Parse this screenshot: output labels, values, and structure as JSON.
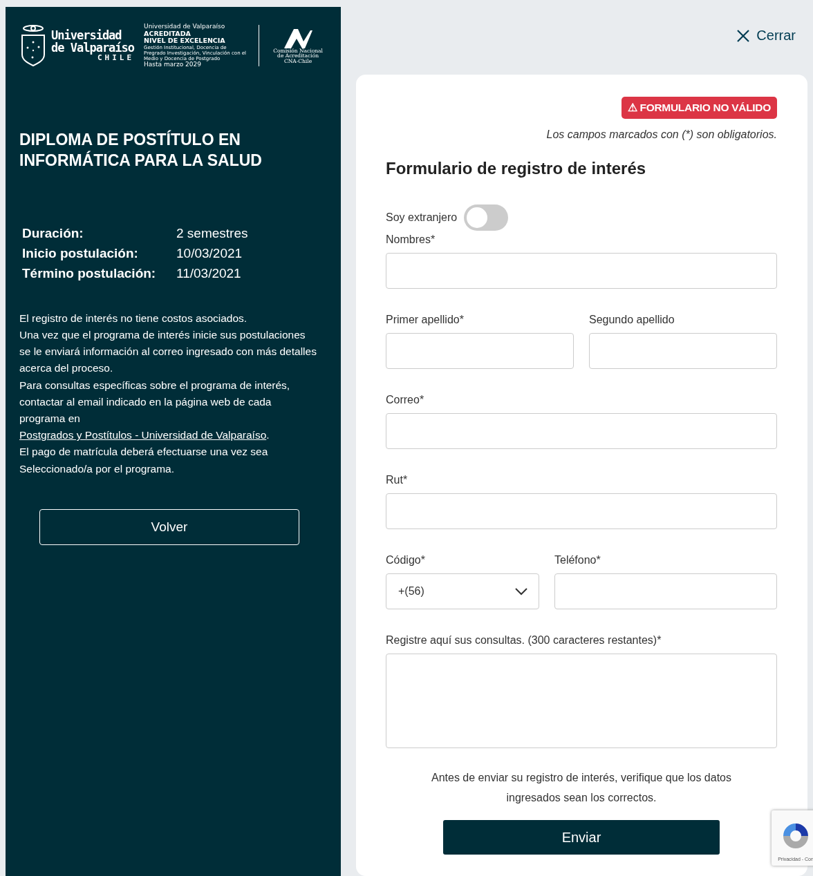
{
  "sidebar": {
    "university_logo": {
      "line_1": "Universidad",
      "line_2": "de Valparaíso",
      "line_3": "CHILE"
    },
    "accreditation": {
      "university": "Universidad de Valparaíso",
      "status": "ACREDITADA",
      "level": "NIVEL DE EXCELENCIA",
      "areas": "Gestión Institucional, Docencia de Pregrado Investigación, Vinculación con el Medio y Docencia de Postgrado",
      "until": "Hasta marzo 2029",
      "agency": "Comisión Nacional de Acreditación",
      "agency_short": "CNA-Chile"
    },
    "program_title": "DIPLOMA DE POSTÍTULO EN INFORMÁTICA PARA LA SALUD",
    "details": [
      {
        "label": "Duración:",
        "value": "2 semestres"
      },
      {
        "label": "Inicio postulación:",
        "value": "10/03/2021"
      },
      {
        "label": "Término postulación:",
        "value": "11/03/2021"
      }
    ],
    "info": [
      {
        "text": "El registro de interés no tiene costos asociados."
      },
      {
        "text": "Una vez que el programa de interés inicie sus postulaciones se le enviará información al correo ingresado con más detalles acerca del proceso."
      },
      {
        "text": "Para consultas específicas sobre el programa de interés, contactar al email indicado en la página web de cada programa en ",
        "link": "Postgrados y Postítulos - Universidad de Valparaíso",
        "after": "."
      },
      {
        "text": "El pago de matrícula deberá efectuarse una vez sea Seleccionado/a por el programa."
      }
    ],
    "back_button": "Volver"
  },
  "close_button": "Cerrar",
  "form": {
    "alert": "⚠ FORMULARIO NO VÁLIDO",
    "required_note": "Los campos marcados con (*) son obligatorios.",
    "title": "Formulario de registro de interés",
    "foreign_toggle": {
      "label": "Soy extranjero",
      "on": false
    },
    "rows": [
      [
        {
          "kind": "text",
          "label": "Nombres*"
        }
      ],
      [
        {
          "kind": "text",
          "label": "Primer apellido*"
        },
        {
          "kind": "text",
          "label": "Segundo apellido"
        }
      ],
      [
        {
          "kind": "text",
          "label": "Correo*"
        }
      ],
      [
        {
          "kind": "text",
          "label": "Rut*"
        }
      ],
      [
        {
          "kind": "select",
          "label": "Código*",
          "value": "+(56)"
        },
        {
          "kind": "text",
          "label": "Teléfono*"
        }
      ],
      [
        {
          "kind": "textarea",
          "label": "Registre aquí sus consultas. (300 caracteres restantes)*"
        }
      ]
    ],
    "notice": "Antes de enviar su registro de interés, verifique que los datos ingresados sean los correctos.",
    "submit_button": "Enviar"
  },
  "recaptcha": {
    "text": "Privacidad - Con"
  }
}
